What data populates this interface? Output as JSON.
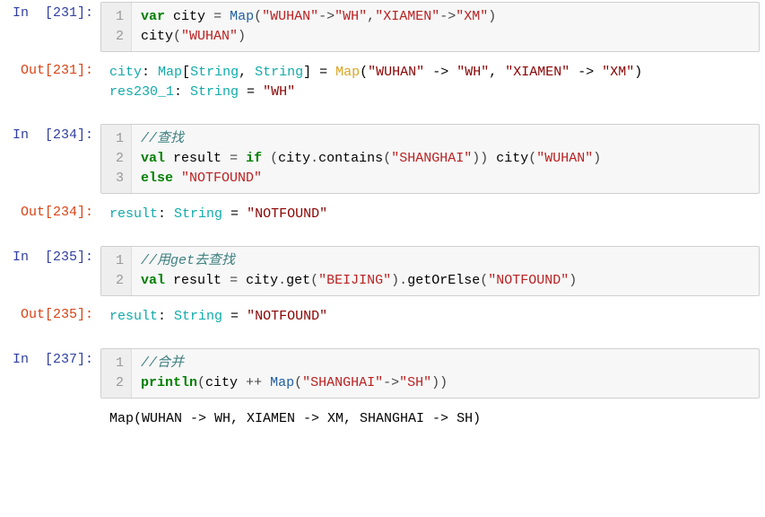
{
  "cells": [
    {
      "type": "in",
      "num": 231,
      "lines": [
        [
          {
            "cls": "kw",
            "t": "var"
          },
          {
            "cls": "",
            "t": " "
          },
          {
            "cls": "var-name",
            "t": "city"
          },
          {
            "cls": "",
            "t": " "
          },
          {
            "cls": "punct",
            "t": "="
          },
          {
            "cls": "",
            "t": " "
          },
          {
            "cls": "func",
            "t": "Map"
          },
          {
            "cls": "punct",
            "t": "("
          },
          {
            "cls": "str",
            "t": "\"WUHAN\""
          },
          {
            "cls": "punct",
            "t": "->"
          },
          {
            "cls": "str",
            "t": "\"WH\""
          },
          {
            "cls": "punct",
            "t": ","
          },
          {
            "cls": "str",
            "t": "\"XIAMEN\""
          },
          {
            "cls": "punct",
            "t": "->"
          },
          {
            "cls": "str",
            "t": "\"XM\""
          },
          {
            "cls": "punct",
            "t": ")"
          }
        ],
        [
          {
            "cls": "var-name",
            "t": "city"
          },
          {
            "cls": "punct",
            "t": "("
          },
          {
            "cls": "str",
            "t": "\"WUHAN\""
          },
          {
            "cls": "punct",
            "t": ")"
          }
        ]
      ]
    },
    {
      "type": "out",
      "num": 231,
      "lines_out": [
        [
          {
            "cls": "out-name",
            "t": "city"
          },
          {
            "cls": "out-punct",
            "t": ": "
          },
          {
            "cls": "out-type",
            "t": "Map"
          },
          {
            "cls": "out-punct",
            "t": "["
          },
          {
            "cls": "out-type",
            "t": "String"
          },
          {
            "cls": "out-punct",
            "t": ", "
          },
          {
            "cls": "out-type",
            "t": "String"
          },
          {
            "cls": "out-punct",
            "t": "]"
          },
          {
            "cls": "out-op",
            "t": " = "
          },
          {
            "cls": "out-map",
            "t": "Map"
          },
          {
            "cls": "out-punct",
            "t": "("
          },
          {
            "cls": "out-str",
            "t": "\"WUHAN\""
          },
          {
            "cls": "out-op",
            "t": " -> "
          },
          {
            "cls": "out-str",
            "t": "\"WH\""
          },
          {
            "cls": "out-punct",
            "t": ", "
          },
          {
            "cls": "out-str",
            "t": "\"XIAMEN\""
          },
          {
            "cls": "out-op",
            "t": " -> "
          },
          {
            "cls": "out-str",
            "t": "\"XM\""
          },
          {
            "cls": "out-punct",
            "t": ")"
          }
        ],
        [
          {
            "cls": "out-name",
            "t": "res230_1"
          },
          {
            "cls": "out-punct",
            "t": ": "
          },
          {
            "cls": "out-type",
            "t": "String"
          },
          {
            "cls": "out-op",
            "t": " = "
          },
          {
            "cls": "out-str",
            "t": "\"WH\""
          }
        ]
      ]
    },
    {
      "type": "in",
      "num": 234,
      "lines": [
        [
          {
            "cls": "cm",
            "t": "//查找"
          }
        ],
        [
          {
            "cls": "kw",
            "t": "val"
          },
          {
            "cls": "",
            "t": " "
          },
          {
            "cls": "var-name",
            "t": "result"
          },
          {
            "cls": "",
            "t": " "
          },
          {
            "cls": "punct",
            "t": "="
          },
          {
            "cls": "",
            "t": " "
          },
          {
            "cls": "kw",
            "t": "if"
          },
          {
            "cls": "",
            "t": " "
          },
          {
            "cls": "punct",
            "t": "("
          },
          {
            "cls": "var-name",
            "t": "city"
          },
          {
            "cls": "punct",
            "t": "."
          },
          {
            "cls": "var-name",
            "t": "contains"
          },
          {
            "cls": "punct",
            "t": "("
          },
          {
            "cls": "str",
            "t": "\"SHANGHAI\""
          },
          {
            "cls": "punct",
            "t": "))"
          },
          {
            "cls": "",
            "t": " "
          },
          {
            "cls": "var-name",
            "t": "city"
          },
          {
            "cls": "punct",
            "t": "("
          },
          {
            "cls": "str",
            "t": "\"WUHAN\""
          },
          {
            "cls": "punct",
            "t": ")"
          }
        ],
        [
          {
            "cls": "kw",
            "t": "else"
          },
          {
            "cls": "",
            "t": " "
          },
          {
            "cls": "str",
            "t": "\"NOTFOUND\""
          }
        ]
      ]
    },
    {
      "type": "out",
      "num": 234,
      "lines_out": [
        [
          {
            "cls": "out-name",
            "t": "result"
          },
          {
            "cls": "out-punct",
            "t": ": "
          },
          {
            "cls": "out-type",
            "t": "String"
          },
          {
            "cls": "out-op",
            "t": " = "
          },
          {
            "cls": "out-str",
            "t": "\"NOTFOUND\""
          }
        ]
      ]
    },
    {
      "type": "in",
      "num": 235,
      "lines": [
        [
          {
            "cls": "cm",
            "t": "//用get去查找"
          }
        ],
        [
          {
            "cls": "kw",
            "t": "val"
          },
          {
            "cls": "",
            "t": " "
          },
          {
            "cls": "var-name",
            "t": "result"
          },
          {
            "cls": "",
            "t": " "
          },
          {
            "cls": "punct",
            "t": "="
          },
          {
            "cls": "",
            "t": " "
          },
          {
            "cls": "var-name",
            "t": "city"
          },
          {
            "cls": "punct",
            "t": "."
          },
          {
            "cls": "var-name",
            "t": "get"
          },
          {
            "cls": "punct",
            "t": "("
          },
          {
            "cls": "str",
            "t": "\"BEIJING\""
          },
          {
            "cls": "punct",
            "t": ")."
          },
          {
            "cls": "var-name",
            "t": "getOrElse"
          },
          {
            "cls": "punct",
            "t": "("
          },
          {
            "cls": "str",
            "t": "\"NOTFOUND\""
          },
          {
            "cls": "punct",
            "t": ")"
          }
        ]
      ]
    },
    {
      "type": "out",
      "num": 235,
      "lines_out": [
        [
          {
            "cls": "out-name",
            "t": "result"
          },
          {
            "cls": "out-punct",
            "t": ": "
          },
          {
            "cls": "out-type",
            "t": "String"
          },
          {
            "cls": "out-op",
            "t": " = "
          },
          {
            "cls": "out-str",
            "t": "\"NOTFOUND\""
          }
        ]
      ]
    },
    {
      "type": "in",
      "num": 237,
      "lines": [
        [
          {
            "cls": "cm",
            "t": "//合并"
          }
        ],
        [
          {
            "cls": "kw",
            "t": "println"
          },
          {
            "cls": "punct",
            "t": "("
          },
          {
            "cls": "var-name",
            "t": "city"
          },
          {
            "cls": "",
            "t": " "
          },
          {
            "cls": "punct",
            "t": "++"
          },
          {
            "cls": "",
            "t": " "
          },
          {
            "cls": "func",
            "t": "Map"
          },
          {
            "cls": "punct",
            "t": "("
          },
          {
            "cls": "str",
            "t": "\"SHANGHAI\""
          },
          {
            "cls": "punct",
            "t": "->"
          },
          {
            "cls": "str",
            "t": "\"SH\""
          },
          {
            "cls": "punct",
            "t": "))"
          }
        ]
      ]
    },
    {
      "type": "stdout",
      "lines_out": [
        [
          {
            "cls": "",
            "t": "Map(WUHAN -> WH, XIAMEN -> XM, SHANGHAI -> SH)"
          }
        ]
      ]
    }
  ],
  "prompt_in": "In  ",
  "prompt_out": "Out"
}
